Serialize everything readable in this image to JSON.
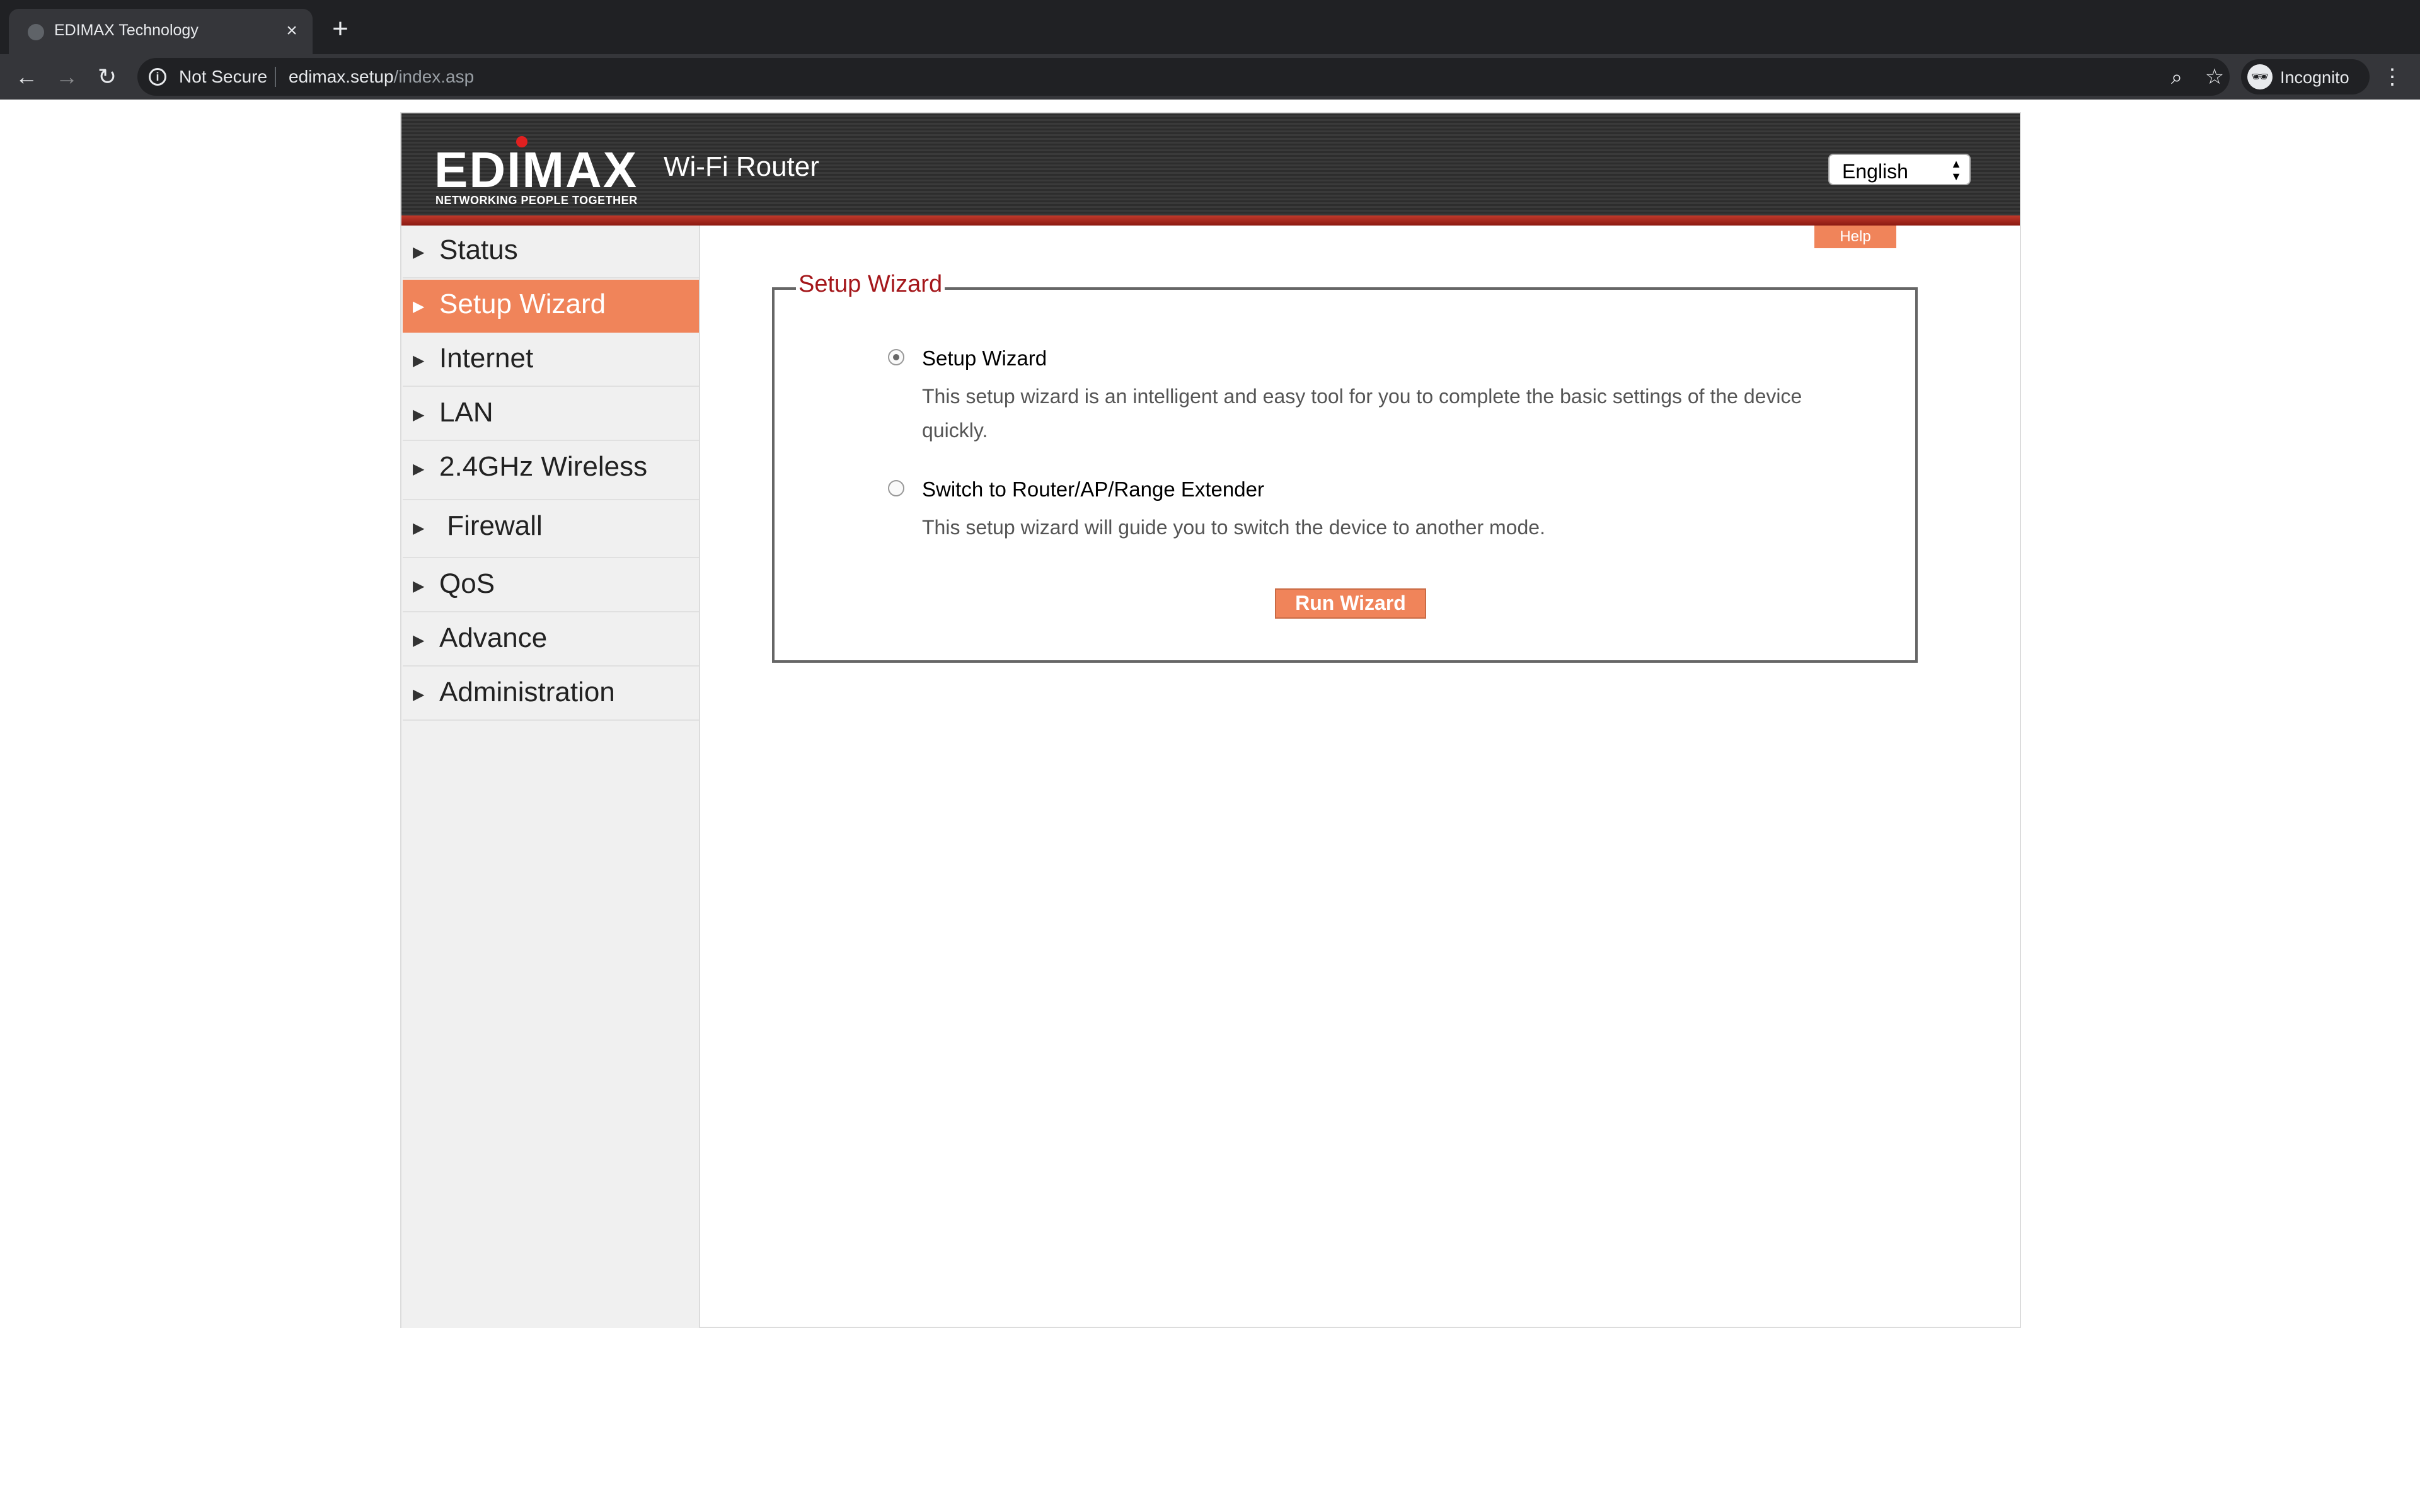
{
  "browser": {
    "tab_title": "EDIMAX Technology",
    "tab_close": "×",
    "new_tab": "+",
    "security_label": "Not Secure",
    "url_host": "edimax.setup",
    "url_path": "/index.asp",
    "profile_label": "Incognito"
  },
  "header": {
    "logo_text": "EDIMAX",
    "logo_tagline": "NETWORKING PEOPLE TOGETHER",
    "product_title": "Wi-Fi Router",
    "language": "English",
    "accent_color": "#f0845a",
    "brand_red": "#c0392b"
  },
  "sidebar": {
    "items": [
      {
        "label": "Status"
      },
      {
        "label": "Setup Wizard",
        "active": true
      },
      {
        "label": "Internet"
      },
      {
        "label": "LAN"
      },
      {
        "label": "2.4GHz Wireless"
      },
      {
        "label": " Firewall"
      },
      {
        "label": "QoS"
      },
      {
        "label": "Advance"
      },
      {
        "label": "Administration"
      }
    ]
  },
  "content": {
    "help_label": "Help",
    "legend": "Setup Wizard",
    "options": [
      {
        "title": "Setup Wizard",
        "description": "This setup wizard is an intelligent and easy tool for you to complete the basic settings of the device quickly.",
        "selected": true
      },
      {
        "title": "Switch to Router/AP/Range Extender",
        "description": "This setup wizard will guide you to switch the device to another mode.",
        "selected": false
      }
    ],
    "run_button": "Run Wizard"
  }
}
